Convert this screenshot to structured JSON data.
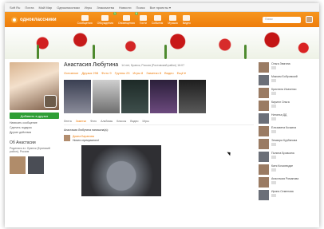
{
  "browser": {
    "links": [
      "Soft Ru",
      "Почта",
      "Мой Мир",
      "Одноклассники",
      "Игры",
      "Знакомства",
      "Новости",
      "Поиск",
      "Все проекты ▾"
    ]
  },
  "topbar": {
    "logo_text": "одноклассники",
    "nav": [
      {
        "icon": "envelope-icon",
        "label": "Сообщения",
        "badge": ""
      },
      {
        "icon": "people-icon",
        "label": "Обсуждения",
        "badge": "1"
      },
      {
        "icon": "bell-icon",
        "label": "Оповещения",
        "badge": "8"
      },
      {
        "icon": "guests-icon",
        "label": "Гости",
        "badge": ""
      },
      {
        "icon": "event-icon",
        "label": "События",
        "badge": ""
      },
      {
        "icon": "music-icon",
        "label": "Музыка",
        "badge": ""
      },
      {
        "icon": "video-icon",
        "label": "Видео",
        "badge": ""
      }
    ],
    "search_placeholder": "Поиск"
  },
  "profile": {
    "name": "Анастасия Любутина",
    "meta": "14 лет, Бранск, Россия (Ростовский район) 16:07",
    "menu": [
      "Основное",
      "Друзья 298",
      "Фото 9",
      "Группы 23",
      "Игры 8",
      "Заметки 8",
      "Видео",
      "Ещё ▾"
    ],
    "add_friend": "Добавить в друзья",
    "side_links": [
      "Написать сообщение",
      "Сделать подарок",
      "Другие действия"
    ],
    "about_title": "Об Анастасии",
    "about_text": "Родилась в г. Брянск (Брянский район), Россия",
    "subtabs": [
      "Лента",
      "Заметки",
      "Фото",
      "Альбомы",
      "Классы",
      "Видео",
      "Игры"
    ],
    "status_line": "Анастасия Любутина написала(а):",
    "post_author": "Диана Баранова",
    "post_text": "Ничего прекрасного!"
  },
  "friends": [
    "Ольга Звягина",
    "Максим Бобровский",
    "Кристина Исаченко",
    "Кирилл Ольга",
    "Наталья ДД",
    "Елизавета Кочкина",
    "Эльвира Курбанова",
    "Полина Бровкина",
    "Катя Кочкинидзе",
    "Анастасия Романова",
    "Ирина Семенова"
  ]
}
